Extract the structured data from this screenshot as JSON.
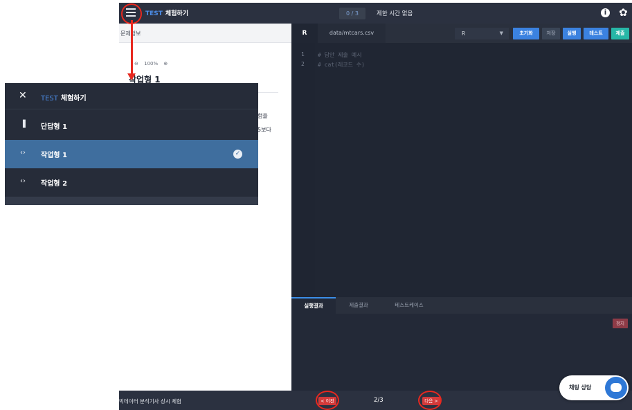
{
  "topbar": {
    "brand_test": "TEST",
    "brand_name": "체험하기",
    "question_counter": "0 / 3",
    "time_limit": "제한 시간 없음",
    "info_glyph": "i",
    "gear_glyph": "✿",
    "icons": [
      "menu-icon",
      "info-icon",
      "gear-icon"
    ]
  },
  "left_panel": {
    "tab_label": "문제정보",
    "zoom_out": "⊖",
    "zoom_level": "100%",
    "zoom_in": "⊕",
    "task_title": "작업형 1",
    "body_line1": "험을",
    "body_line2": "5보다"
  },
  "editor": {
    "tab_lang": "R",
    "tab_file": "data/mtcars.csv",
    "language_select": "R",
    "buttons": {
      "reset": "초기화",
      "save": "저장",
      "run": "실행",
      "test": "테스트",
      "submit": "제출"
    },
    "lines": [
      {
        "num": "1",
        "text": "# 답안 제출 예시"
      },
      {
        "num": "2",
        "text": "# cat(레코드 수)"
      }
    ]
  },
  "results": {
    "tab_run": "실행결과",
    "tab_submit": "제출결과",
    "tab_testcase": "테스트케이스",
    "stop_button": "정지"
  },
  "bottombar": {
    "title": "빅데이터 분석기사 상시 체험",
    "prev": "< 이전",
    "page_indicator": "2/3",
    "next": "다음 >"
  },
  "chat": {
    "label": "채팅 상담"
  },
  "menu": {
    "close_glyph": "✕",
    "title_test": "TEST",
    "title_name": "체험하기",
    "items": [
      {
        "icon": "▐",
        "label": "단답형 1",
        "active": false
      },
      {
        "icon": "‹›",
        "label": "작업형 1",
        "active": true
      },
      {
        "icon": "‹›",
        "label": "작업형 2",
        "active": false
      }
    ],
    "check_glyph": "✓"
  },
  "colors": {
    "topbar_bg": "#2b3140",
    "editor_bg": "#202633",
    "accent_blue": "#4c8de8",
    "active_menu": "#3f6e9e",
    "annotation_red": "#e8281f",
    "btn_reset": "#3b82e0",
    "btn_save": "#3a4556",
    "btn_run": "#3b82e0",
    "btn_test": "#3b82e0",
    "btn_submit": "#27b7a7"
  }
}
